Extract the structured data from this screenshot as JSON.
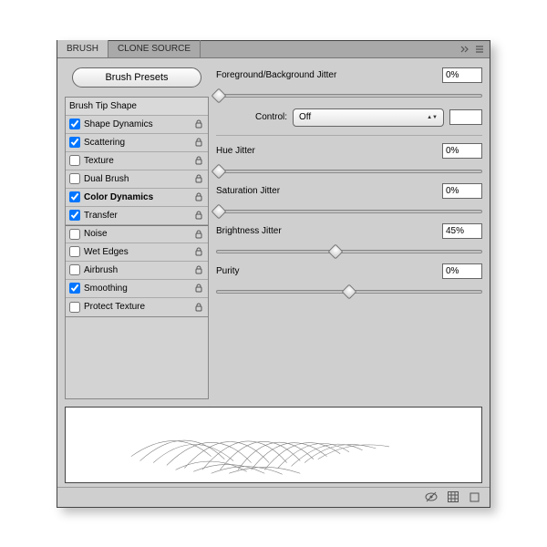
{
  "tabs": {
    "brush": "BRUSH",
    "clone_source": "CLONE SOURCE"
  },
  "presets_button": "Brush Presets",
  "options": {
    "tip_shape": "Brush Tip Shape",
    "shape_dynamics": {
      "label": "Shape Dynamics",
      "checked": true
    },
    "scattering": {
      "label": "Scattering",
      "checked": true
    },
    "texture": {
      "label": "Texture",
      "checked": false
    },
    "dual_brush": {
      "label": "Dual Brush",
      "checked": false
    },
    "color_dynamics": {
      "label": "Color Dynamics",
      "checked": true
    },
    "transfer": {
      "label": "Transfer",
      "checked": true
    },
    "noise": {
      "label": "Noise",
      "checked": false
    },
    "wet_edges": {
      "label": "Wet Edges",
      "checked": false
    },
    "airbrush": {
      "label": "Airbrush",
      "checked": false
    },
    "smoothing": {
      "label": "Smoothing",
      "checked": true
    },
    "protect_texture": {
      "label": "Protect Texture",
      "checked": false
    }
  },
  "settings": {
    "fgbg_jitter": {
      "label": "Foreground/Background Jitter",
      "value": "0%",
      "pos": 0
    },
    "control": {
      "label": "Control:",
      "value": "Off",
      "extra": ""
    },
    "hue_jitter": {
      "label": "Hue Jitter",
      "value": "0%",
      "pos": 0
    },
    "sat_jitter": {
      "label": "Saturation Jitter",
      "value": "0%",
      "pos": 0
    },
    "bright_jitter": {
      "label": "Brightness Jitter",
      "value": "45%",
      "pos": 45
    },
    "purity": {
      "label": "Purity",
      "value": "0%",
      "pos": 50
    }
  }
}
